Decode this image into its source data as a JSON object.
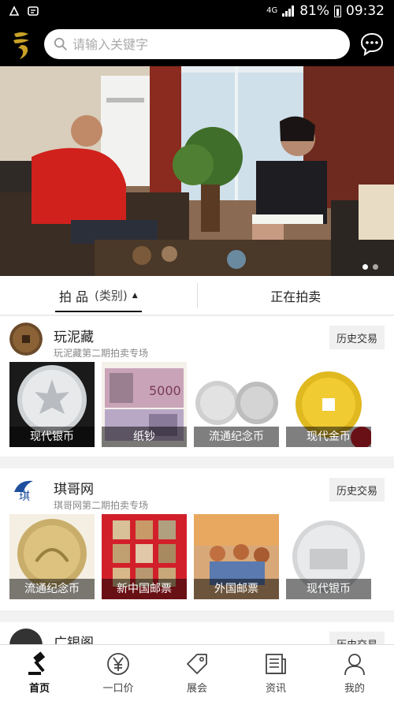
{
  "status_bar": {
    "network": "4G",
    "battery": "81%",
    "time": "09:32"
  },
  "search": {
    "placeholder": "请输入关键字"
  },
  "tabs": [
    {
      "label": "拍 品",
      "sub": "(类别)"
    },
    {
      "label": "正在拍卖"
    }
  ],
  "sections": [
    {
      "title": "玩泥藏",
      "subtitle": "玩泥藏第二期拍卖专场",
      "history_label": "历史交易",
      "items": [
        "现代银币",
        "纸钞",
        "流通纪念币",
        "现代金币"
      ]
    },
    {
      "title": "琪哥网",
      "subtitle": "琪哥网第二期拍卖专场",
      "history_label": "历史交易",
      "items": [
        "流通纪念币",
        "新中国邮票",
        "外国邮票",
        "现代银币"
      ]
    },
    {
      "title": "广银阁",
      "history_label": "历史交易"
    }
  ],
  "bottom_nav": [
    {
      "label": "首页",
      "icon": "gavel-icon"
    },
    {
      "label": "一口价",
      "icon": "yen-icon"
    },
    {
      "label": "展会",
      "icon": "tag-icon"
    },
    {
      "label": "资讯",
      "icon": "news-icon"
    },
    {
      "label": "我的",
      "icon": "user-icon"
    }
  ],
  "colors": {
    "header_bg": "#000000",
    "logo_gold": "#c9a227"
  }
}
